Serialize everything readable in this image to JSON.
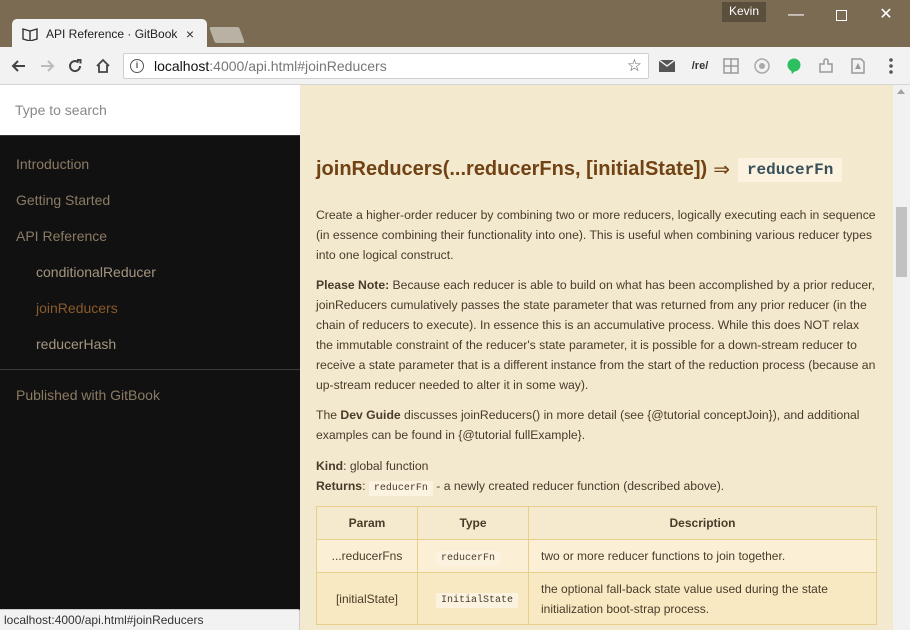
{
  "browser": {
    "tab_title": "API Reference · GitBook",
    "tab_close": "×",
    "user": "Kevin",
    "controls": {
      "minimize": "—",
      "maximize": "",
      "close": "✕"
    },
    "url_host": "localhost",
    "url_path": ":4000/api.html#joinReducers",
    "extensions": [
      "mail-icon",
      "regex-icon",
      "grid-icon",
      "target-icon",
      "evernote-icon",
      "puzzle-icon",
      "pdf-icon",
      "menu-icon"
    ],
    "regex_label": "/re/",
    "status_bar": "localhost:4000/api.html#joinReducers"
  },
  "sidebar": {
    "search_placeholder": "Type to search",
    "items": [
      {
        "label": "Introduction"
      },
      {
        "label": "Getting Started"
      },
      {
        "label": "API Reference"
      }
    ],
    "children": [
      {
        "label": "conditionalReducer"
      },
      {
        "label": "joinReducers",
        "active": true
      },
      {
        "label": "reducerHash"
      }
    ],
    "published": "Published with GitBook"
  },
  "content": {
    "signature": "joinReducers(...reducerFns, [initialState])",
    "arrow": "⇒",
    "return_type": "reducerFn",
    "p1": "Create a higher-order reducer by combining two or more reducers, logically executing each in sequence (in essence combining their functionality into one). This is useful when combining various reducer types into one logical construct.",
    "p2_label": "Please Note:",
    "p2": " Because each reducer is able to build on what has been accomplished by a prior reducer, joinReducers cumulatively passes the state parameter that was returned from any prior reducer (in the chain of reducers to execute). In essence this is an accumulative process. While this does NOT relax the immutable constraint of the reducer's state parameter, it is possible for a down-stream reducer to receive a state parameter that is a different instance from the start of the reduction process (because an up-stream reducer needed to alter it in some way).",
    "p3_pre": "The ",
    "p3_label": "Dev Guide",
    "p3": " discusses joinReducers() in more detail (see {@tutorial conceptJoin}), and additional examples can be found in {@tutorial fullExample}.",
    "kind_label": "Kind",
    "kind": ": global function",
    "returns_label": "Returns",
    "returns_colon": ": ",
    "returns_code": "reducerFn",
    "returns_text": " - a newly created reducer function (described above).",
    "table": {
      "headers": [
        "Param",
        "Type",
        "Description"
      ],
      "rows": [
        {
          "param": "...reducerFns",
          "type": "reducerFn",
          "desc": "two or more reducer functions to join together."
        },
        {
          "param": "[initialState]",
          "type": "InitialState",
          "desc": "the optional fall-back state value used during the state initialization boot-strap process."
        }
      ]
    }
  }
}
